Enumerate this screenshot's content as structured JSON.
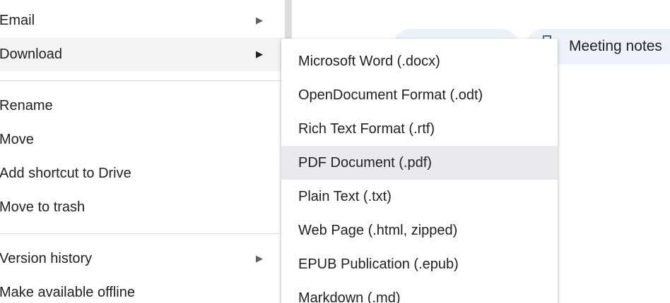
{
  "main_menu": {
    "items": [
      {
        "label": "Email",
        "arrow": "▶"
      },
      {
        "label": "Download",
        "arrow": "▶"
      },
      {
        "label": "Rename"
      },
      {
        "label": "Move"
      },
      {
        "label": "Add shortcut to Drive"
      },
      {
        "label": "Move to trash"
      },
      {
        "label": "Version history",
        "arrow": "▶"
      },
      {
        "label": "Make available offline"
      }
    ]
  },
  "download_submenu": {
    "items": [
      {
        "label": "Microsoft Word (.docx)"
      },
      {
        "label": "OpenDocument Format (.odt)"
      },
      {
        "label": "Rich Text Format (.rtf)"
      },
      {
        "label": "PDF Document (.pdf)"
      },
      {
        "label": "Plain Text (.txt)"
      },
      {
        "label": "Web Page (.html, zipped)"
      },
      {
        "label": "EPUB Publication (.epub)"
      },
      {
        "label": "Markdown (.md)"
      }
    ]
  },
  "background": {
    "meeting_notes_chip": "Meeting notes"
  },
  "colors": {
    "hover_main": "#f1f3f4",
    "hover_sub": "#e8eaed",
    "chip_bg": "#edf2fa",
    "text": "#202124"
  }
}
